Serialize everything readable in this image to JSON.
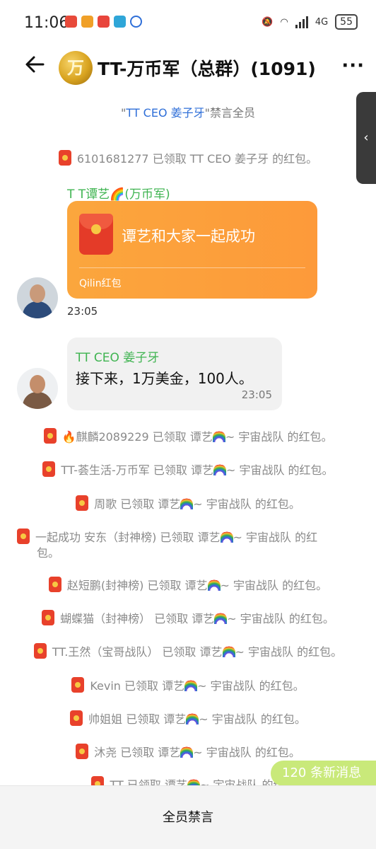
{
  "status_bar": {
    "time": "11:06",
    "network": "4G",
    "battery": "55"
  },
  "header": {
    "avatar_char": "万",
    "title": "TT-万币军（总群）(1091)",
    "back_icon": "arrow-left-icon",
    "more_label": "···"
  },
  "notice": {
    "prefix": "\"",
    "highlight": "TT CEO 姜子牙",
    "suffix": "\"禁言全员"
  },
  "messages": {
    "sys_1": "6101681277 已领取 TT CEO 姜子牙 的红包。",
    "hongbao_sender": "T T谭艺🌈(万币军)",
    "hongbao_title": "谭艺和大家一起成功",
    "hongbao_brand": "Qilin红包",
    "hongbao_time": "23:05",
    "text_sender": "TT CEO 姜子牙",
    "text_body": "接下来，1万美金，100人。",
    "text_time": "23:05"
  },
  "claims": [
    {
      "prefix": "🔥",
      "name": "麒麟2089229",
      "mid": " 已领取 谭艺",
      "tail": "~ 宇宙战队 的红包。"
    },
    {
      "prefix": "",
      "name": "TT-荟生活-万币军",
      "mid": " 已领取 谭艺",
      "tail": "~ 宇宙战队 的红包。"
    },
    {
      "prefix": "",
      "name": "周歌",
      "mid": " 已领取 谭艺",
      "tail": "~ 宇宙战队 的红包。"
    },
    {
      "prefix": "",
      "name": "一起成功 安东（封神榜)",
      "mid": " 已领取 谭艺",
      "tail": "~ 宇宙战队 的红",
      "tail2": "包。"
    },
    {
      "prefix": "",
      "name": "赵短鹏(封神榜)",
      "mid": " 已领取 谭艺",
      "tail": "~ 宇宙战队 的红包。"
    },
    {
      "prefix": "",
      "name": "蝴蝶猫（封神榜）",
      "mid": " 已领取 谭艺",
      "tail": "~ 宇宙战队 的红包。"
    },
    {
      "prefix": "",
      "name": "TT.王然（宝哥战队）",
      "mid": " 已领取 谭艺",
      "tail": "~ 宇宙战队 的红包。"
    },
    {
      "prefix": "",
      "name": "Kevin",
      "mid": " 已领取 谭艺",
      "tail": "~ 宇宙战队 的红包。"
    },
    {
      "prefix": "",
      "name": "帅姐姐",
      "mid": " 已领取 谭艺",
      "tail": "~ 宇宙战队 的红包。"
    },
    {
      "prefix": "",
      "name": "沐尧",
      "mid": " 已领取 谭艺",
      "tail": "~ 宇宙战队 的红包。"
    },
    {
      "prefix": "",
      "name": "TT",
      "mid": " 已领取 谭艺",
      "tail": "~ 宇宙战队 的红"
    }
  ],
  "new_messages": "120 条新消息",
  "bottom_bar": "全员禁言",
  "colors": {
    "accent_green": "#3fb451",
    "hongbao_orange": "#fd9a3a",
    "new_msg_badge": "#c9e97a"
  }
}
